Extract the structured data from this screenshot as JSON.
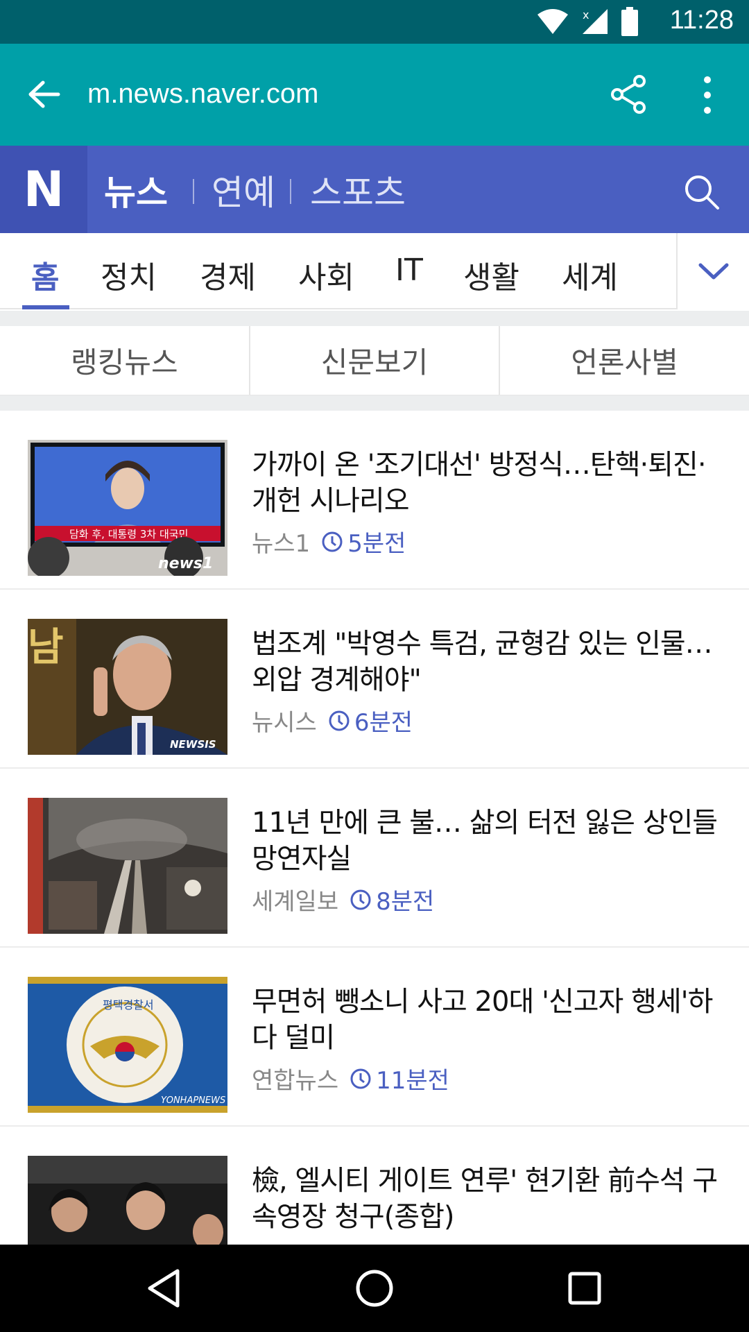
{
  "status_bar": {
    "time": "11:28"
  },
  "browser": {
    "url": "m.news.naver.com"
  },
  "naver_header": {
    "logo": "N",
    "sections": [
      "뉴스",
      "연예",
      "스포츠"
    ]
  },
  "categories": [
    "홈",
    "정치",
    "경제",
    "사회",
    "IT",
    "생활",
    "세계"
  ],
  "subtabs": [
    "랭킹뉴스",
    "신문보기",
    "언론사별"
  ],
  "articles": [
    {
      "title": "가까이 온 '조기대선' 방정식…탄핵·퇴진·개헌 시나리오",
      "press": "뉴스1",
      "time": "5분전"
    },
    {
      "title": "법조계 \"박영수 특검, 균형감 있는 인물…외압 경계해야\"",
      "press": "뉴시스",
      "time": "6분전"
    },
    {
      "title": "11년 만에 큰 불… 삶의 터전 잃은 상인들 망연자실",
      "press": "세계일보",
      "time": "8분전"
    },
    {
      "title": "무면허 뺑소니 사고 20대 '신고자 행세'하다 덜미",
      "press": "연합뉴스",
      "time": "11분전"
    },
    {
      "title": "檢, 엘시티 게이트 연루' 현기환 前수석 구속영장 청구(종합)",
      "press": "",
      "time": ""
    }
  ],
  "thumb_text": {
    "tv_caption": "담화 후, 대통령 3차 대국민",
    "news1": "news1",
    "newsis": "NEWSIS",
    "sign": "남",
    "police": "평택경찰서",
    "yonhap": "YONHAPNEWS"
  },
  "colors": {
    "accent": "#4a5fc1",
    "toolbar": "#00a0a8",
    "statusbar": "#00606b"
  }
}
